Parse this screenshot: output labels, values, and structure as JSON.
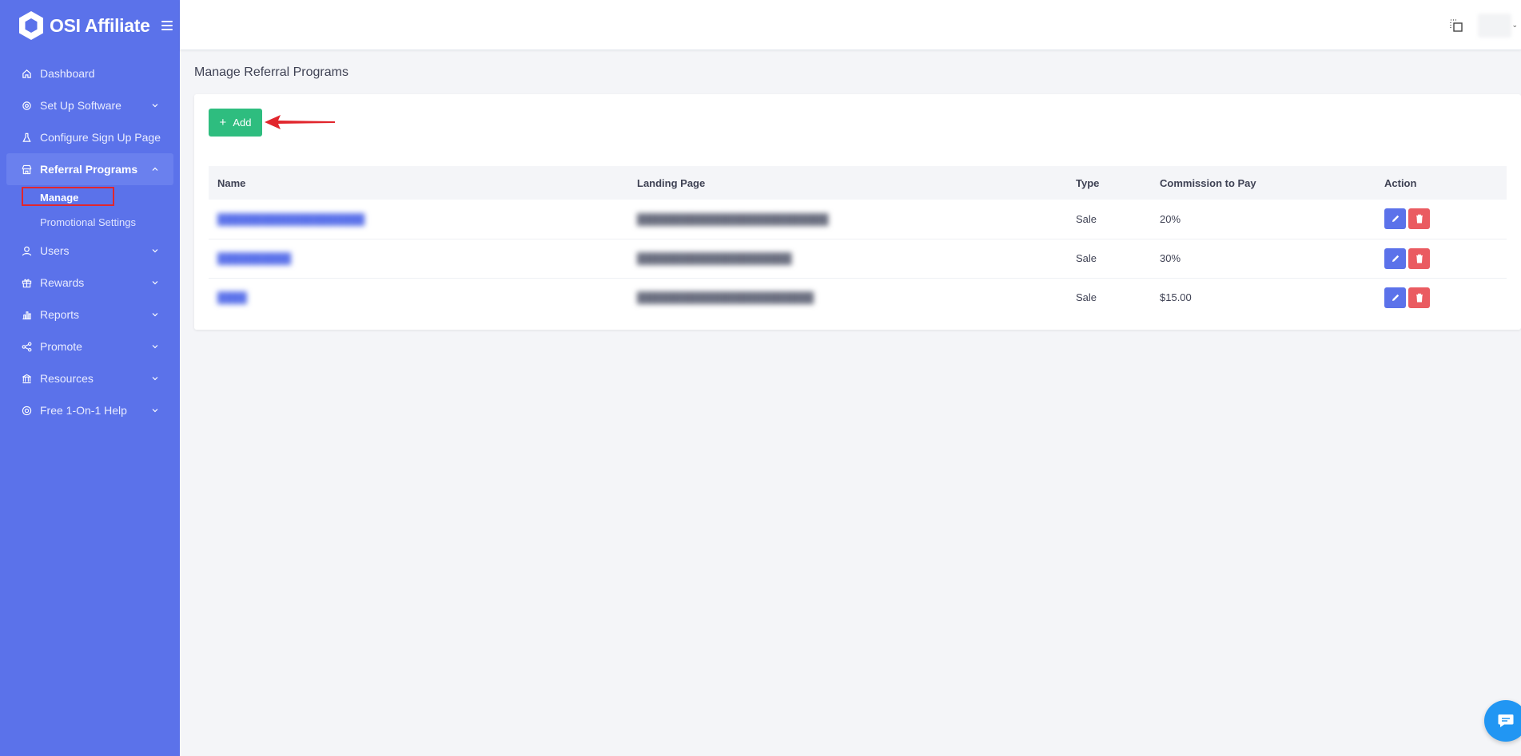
{
  "app": {
    "name": "OSI Affiliate"
  },
  "colors": {
    "sidebar": "#5b72ea",
    "add_button": "#2ebd7f",
    "edit_button": "#5b72ea",
    "delete_button": "#ea5b61",
    "highlight": "#e1262d"
  },
  "sidebar": {
    "items": [
      {
        "label": "Dashboard",
        "icon": "home-icon"
      },
      {
        "label": "Set Up Software",
        "icon": "gear-icon",
        "chevron": "down"
      },
      {
        "label": "Configure Sign Up Page",
        "icon": "flask-icon"
      },
      {
        "label": "Referral Programs",
        "icon": "store-icon",
        "chevron": "up",
        "active": true
      },
      {
        "label": "Users",
        "icon": "user-icon",
        "chevron": "down"
      },
      {
        "label": "Rewards",
        "icon": "gift-icon",
        "chevron": "down"
      },
      {
        "label": "Reports",
        "icon": "bar-chart-icon",
        "chevron": "down"
      },
      {
        "label": "Promote",
        "icon": "share-icon",
        "chevron": "down"
      },
      {
        "label": "Resources",
        "icon": "bank-icon",
        "chevron": "down"
      },
      {
        "label": "Free 1-On-1 Help",
        "icon": "lifebuoy-icon",
        "chevron": "down"
      }
    ],
    "subitems": [
      {
        "label": "Manage",
        "current": true
      },
      {
        "label": "Promotional Settings"
      }
    ]
  },
  "main": {
    "title": "Manage Referral Programs",
    "add_label": "Add",
    "table": {
      "headers": [
        "Name",
        "Landing Page",
        "Type",
        "Commission to Pay",
        "Action"
      ],
      "rows": [
        {
          "name": "████████████████████",
          "landing": "██████████████████████████",
          "type": "Sale",
          "commission": "20%"
        },
        {
          "name": "██████████",
          "landing": "█████████████████████",
          "type": "Sale",
          "commission": "30%"
        },
        {
          "name": "████",
          "landing": "████████████████████████",
          "type": "Sale",
          "commission": "$15.00"
        }
      ]
    }
  }
}
